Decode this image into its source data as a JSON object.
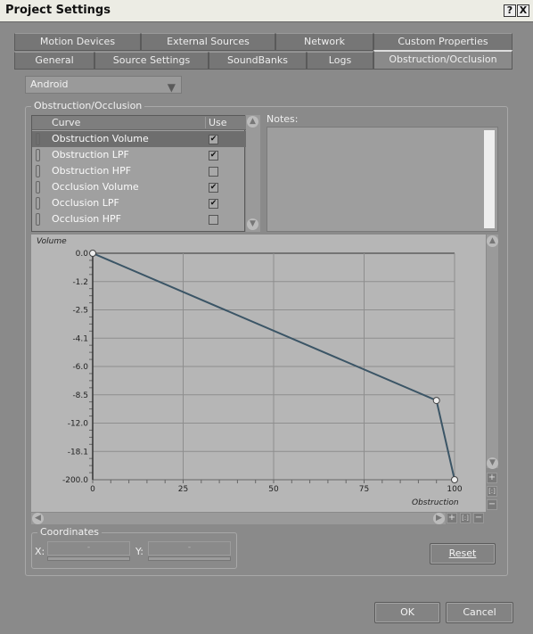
{
  "window": {
    "title": "Project Settings",
    "help": "?",
    "close": "X"
  },
  "tabs_row1": [
    "Motion Devices",
    "External Sources",
    "Network",
    "Custom Properties"
  ],
  "tabs_row2": [
    "General",
    "Source Settings",
    "SoundBanks",
    "Logs",
    "Obstruction/Occlusion"
  ],
  "active_tab": "Obstruction/Occlusion",
  "platform": {
    "selected": "Android"
  },
  "group": {
    "label": "Obstruction/Occlusion"
  },
  "curve_list": {
    "headers": {
      "curve": "Curve",
      "use": "Use"
    },
    "rows": [
      {
        "name": "Obstruction Volume",
        "use": true,
        "selected": true
      },
      {
        "name": "Obstruction LPF",
        "use": true
      },
      {
        "name": "Obstruction HPF",
        "use": false
      },
      {
        "name": "Occlusion Volume",
        "use": true
      },
      {
        "name": "Occlusion LPF",
        "use": true
      },
      {
        "name": "Occlusion HPF",
        "use": false
      }
    ]
  },
  "notes": {
    "label": "Notes:",
    "value": ""
  },
  "chart_data": {
    "type": "line",
    "xlabel": "Obstruction",
    "ylabel": "Volume",
    "x_ticks": [
      "0",
      "25",
      "50",
      "75",
      "100"
    ],
    "xlim": [
      0,
      100
    ],
    "y_ticks": [
      "0.0",
      "-1.2",
      "-2.5",
      "-4.1",
      "-6.0",
      "-8.5",
      "-12.0",
      "-18.1",
      "-200.0"
    ],
    "y_tick_values": [
      0,
      -1.2,
      -2.5,
      -4.1,
      -6.0,
      -8.5,
      -12.0,
      -18.1,
      -200.0
    ],
    "ylim": [
      -200,
      0
    ],
    "grid": true,
    "points": [
      {
        "x": 0,
        "y": 0
      },
      {
        "x": 95,
        "y": -9.2
      },
      {
        "x": 100,
        "y": -200
      }
    ],
    "line_color": "#3b5566"
  },
  "coordinates": {
    "label": "Coordinates",
    "x_label": "X:",
    "y_label": "Y:",
    "x_value": "-",
    "y_value": "-"
  },
  "buttons": {
    "reset": "Reset",
    "ok": "OK",
    "cancel": "Cancel"
  },
  "zoom": {
    "plus": "+",
    "fit": "[:]",
    "minus": "−"
  }
}
